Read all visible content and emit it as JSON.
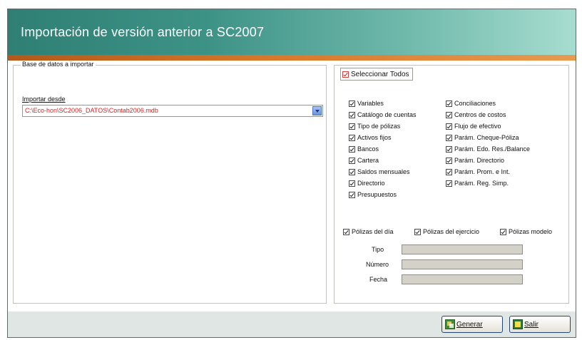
{
  "window": {
    "title": "Importación de versión anterior a SC2007"
  },
  "source_group": {
    "title": "Base de datos a importar",
    "import_label": "Importar desde",
    "import_value": "C:\\Eco-hon\\SC2006_DATOS\\Contab2006.mdb"
  },
  "options": {
    "select_all": "Seleccionar Todos",
    "left_column": [
      "Variables",
      "Catálogo de cuentas",
      "Tipo de pólizas",
      "Activos fijos",
      "Bancos",
      "Cartera",
      "Saldos mensuales",
      "Directorio",
      "Presupuestos"
    ],
    "right_column": [
      "Conciliaciones",
      "Centros de costos",
      "Flujo de efectivo",
      "Parám. Cheque-Póliza",
      "Parám. Edo. Res./Balance",
      "Parám. Directorio",
      "Parám. Prom. e Int.",
      "Parám. Reg. Simp."
    ],
    "poliza_checks": [
      "Pólizas del día",
      "Pólizas del ejercicio",
      "Pólizas modelo"
    ],
    "fields": {
      "tipo": "Tipo",
      "numero": "Número",
      "fecha": "Fecha"
    }
  },
  "buttons": {
    "generar": "Generar",
    "salir": "Salir"
  },
  "colors": {
    "banner": "#3d9286",
    "stripe": "#d5782c",
    "path_text": "#e01e1e"
  }
}
